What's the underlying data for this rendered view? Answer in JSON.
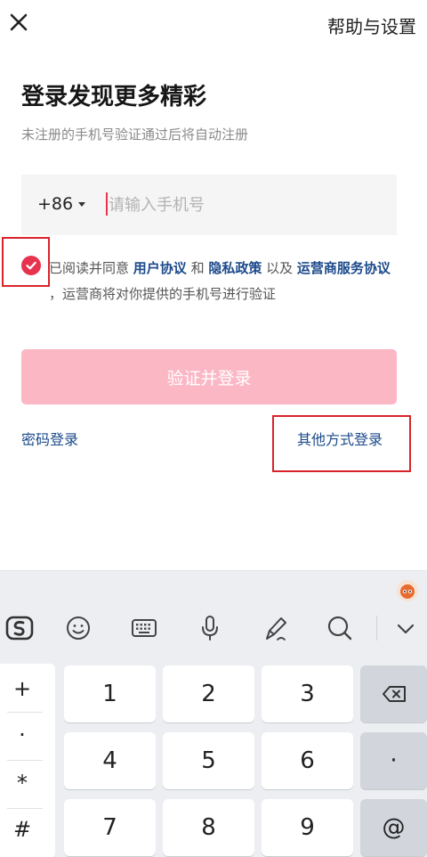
{
  "header": {
    "close_icon": "close-icon",
    "help_label": "帮助与设置"
  },
  "main": {
    "title": "登录发现更多精彩",
    "subtitle": "未注册的手机号验证通过后将自动注册",
    "country_code": "+86",
    "phone_placeholder": "请输入手机号",
    "phone_value": ""
  },
  "agreement": {
    "checked": true,
    "prefix": "已阅读并同意 ",
    "user_agreement": "用户协议",
    "and": " 和 ",
    "privacy_policy": "隐私政策",
    "also": " 以及 ",
    "carrier_agreement": "运营商服务协议",
    "suffix": " ，运营商将对你提供的手机号进行验证"
  },
  "actions": {
    "login_button": "验证并登录",
    "password_login": "密码登录",
    "other_login": "其他方式登录"
  },
  "colors": {
    "accent": "#e8334f",
    "button_disabled": "#fbb7c4",
    "link": "#1c4a8a",
    "highlight_box": "#d9232b"
  },
  "keyboard": {
    "toolbar_icons": [
      "sogou-icon",
      "emoji-icon",
      "keyboard-icon",
      "microphone-icon",
      "handwriting-icon",
      "search-icon",
      "chevron-down-icon"
    ],
    "symbols": [
      "+",
      "·",
      "*",
      "#"
    ],
    "keys": [
      "1",
      "2",
      "3",
      "4",
      "5",
      "6",
      "7",
      "8",
      "9"
    ],
    "dot_key": "·",
    "at_key": "@",
    "backspace_icon": "backspace-icon"
  }
}
